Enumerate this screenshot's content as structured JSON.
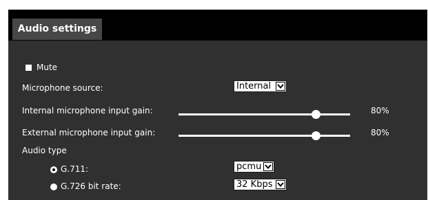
{
  "header": {
    "tab_label": "Audio settings"
  },
  "mute": {
    "label": "Mute",
    "checked": false
  },
  "microphone_source": {
    "label": "Microphone source:",
    "value": "Internal"
  },
  "internal_gain": {
    "label": "Internal microphone input gain:",
    "value_text": "80%",
    "level": 0.8
  },
  "external_gain": {
    "label": "External microphone input gain:",
    "value_text": "80%",
    "level": 0.8
  },
  "audio_type": {
    "label": "Audio type",
    "g711": {
      "label": "G.711:",
      "selected": true,
      "value": "pcmu"
    },
    "g726": {
      "label": "G.726 bit rate:",
      "selected": false,
      "value": "32 Kbps"
    }
  },
  "colors": {
    "panel_bg": "#303030",
    "header_bg": "#000000",
    "tab_bg": "#474747",
    "text": "#ffffff"
  }
}
